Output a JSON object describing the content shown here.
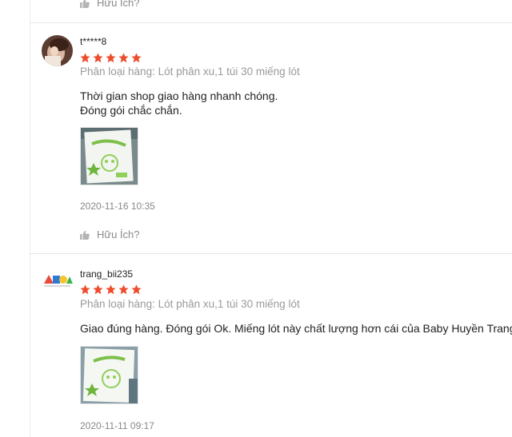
{
  "colors": {
    "star": "#ee4d2d",
    "muted": "#9a9a9a",
    "text": "#222222"
  },
  "helpful_label": "Hữu Ích?",
  "reviews": [
    {
      "username": "t*****8",
      "rating": 5,
      "variation": "Phân loại hàng: Lót phân xu,1 túi 30 miếng lót",
      "comment_lines": [
        "Thời gian shop giao hàng nhanh chóng.",
        "Đóng gói chắc chắn."
      ],
      "date": "2020-11-16 10:35",
      "avatar_icon": "person-photo-avatar"
    },
    {
      "username": "trang_bii235",
      "rating": 5,
      "variation": "Phân loại hàng: Lót phân xu,1 túi 30 miếng lót",
      "comment_lines": [
        "Giao đúng hàng. Đóng gói Ok. Miếng lót này chất lượng hơn cái của Baby Huyền Trang."
      ],
      "date": "2020-11-11 09:17",
      "avatar_icon": "colorful-shapes-logo-avatar"
    }
  ]
}
